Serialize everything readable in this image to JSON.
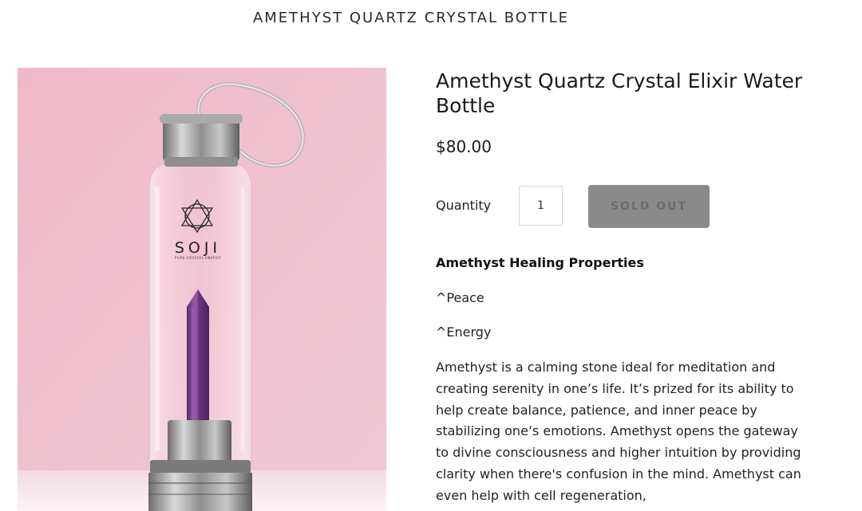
{
  "header": {
    "title": "AMETHYST QUARTZ CRYSTAL BOTTLE"
  },
  "product": {
    "image_brand": "SOJI",
    "image_tagline": "PURE CRYSTAL ENERGY",
    "title": "Amethyst Quartz Crystal Elixir Water Bottle",
    "price": "$80.00",
    "quantity_label": "Quantity",
    "quantity_value": "1",
    "sold_out_label": "SOLD OUT",
    "healing_title": "Amethyst Healing Properties",
    "properties": [
      "^Peace",
      "^Energy"
    ],
    "description": "Amethyst is a calming stone ideal for meditation and creating serenity in one’s life. It’s prized for its ability to help create balance, patience, and inner peace by stabilizing one’s emotions. Amethyst opens the gateway to divine consciousness and higher intuition by providing clarity when there's confusion in the mind. Amethyst can even help with cell regeneration,"
  },
  "colors": {
    "photo_background": "#efc2d0",
    "crystal": "#7b3f8e",
    "button_disabled": "#8a8a8a"
  }
}
